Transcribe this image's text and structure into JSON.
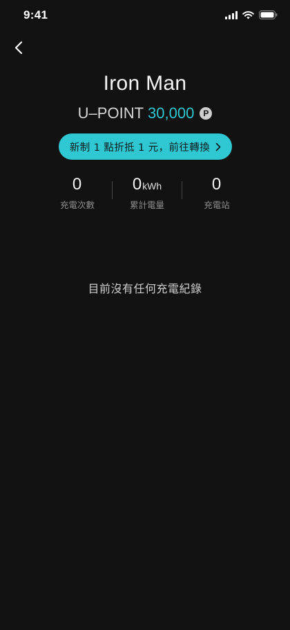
{
  "status_bar": {
    "time": "9:41",
    "icons": [
      "cellular-signal-icon",
      "wifi-icon",
      "battery-icon"
    ]
  },
  "header": {
    "back_icon": "chevron-left-icon"
  },
  "profile": {
    "name": "Iron Man",
    "points_label": "U–POINT",
    "points_value": "30,000",
    "points_badge": "P",
    "accent_color": "#2fc8d2"
  },
  "convert_button": {
    "label": "新制 1 點折抵 1 元，前往轉換",
    "icon": "chevron-right-icon"
  },
  "stats": [
    {
      "value": "0",
      "unit": "",
      "label": "充電次數"
    },
    {
      "value": "0",
      "unit": "kWh",
      "label": "累計電量"
    },
    {
      "value": "0",
      "unit": "",
      "label": "充電站"
    }
  ],
  "empty_state": {
    "message": "目前沒有任何充電紀錄"
  }
}
